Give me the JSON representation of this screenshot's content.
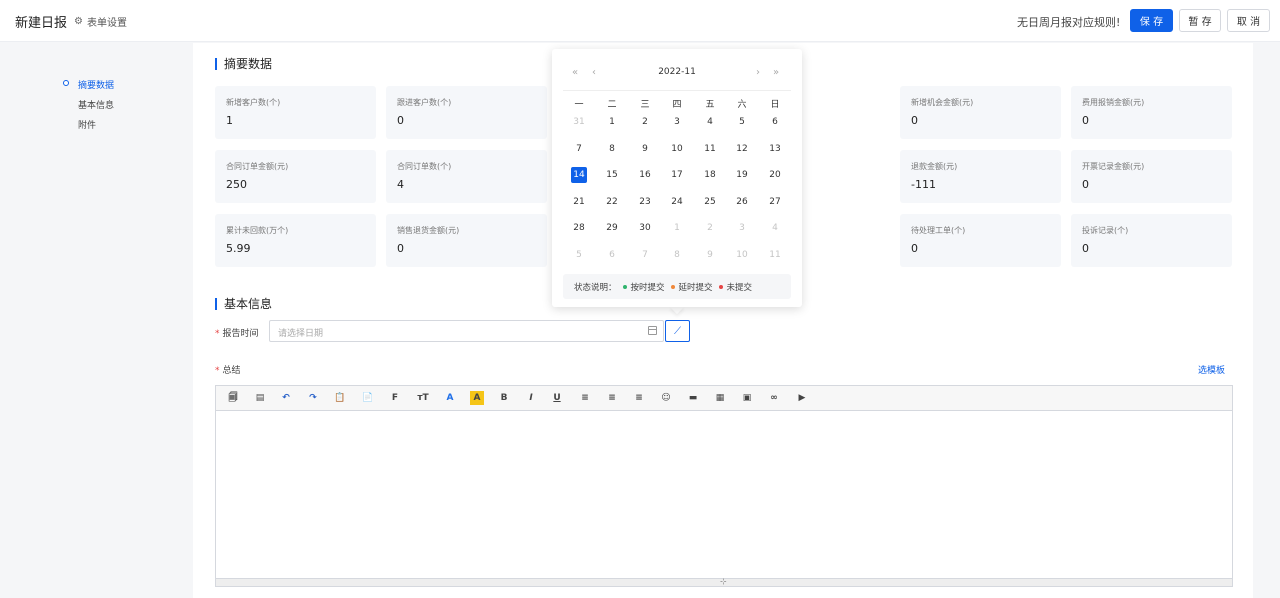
{
  "header": {
    "title": "新建日报",
    "form_settings": "表单设置",
    "rule_text": "无日周月报对应规则!",
    "save": "保 存",
    "draft": "暂 存",
    "cancel": "取 消"
  },
  "sidebar": {
    "items": [
      {
        "label": "摘要数据"
      },
      {
        "label": "基本信息"
      },
      {
        "label": "附件"
      }
    ]
  },
  "summary": {
    "title": "摘要数据",
    "cards": [
      {
        "label": "新增客户数(个)",
        "value": "1"
      },
      {
        "label": "跟进客户数(个)",
        "value": "0"
      },
      {
        "label": "新增机会金额(元)",
        "value": "0"
      },
      {
        "label": "费用报销金额(元)",
        "value": "0"
      },
      {
        "label": "合同订单金额(元)",
        "value": "250"
      },
      {
        "label": "合同订单数(个)",
        "value": "4"
      },
      {
        "label": "退款金额(元)",
        "value": "-111"
      },
      {
        "label": "开票记录金额(元)",
        "value": "0"
      },
      {
        "label": "累计未回款(万个)",
        "value": "5.99"
      },
      {
        "label": "销售退货金额(元)",
        "value": "0"
      },
      {
        "label": "待处理工单(个)",
        "value": "0"
      },
      {
        "label": "投诉记录(个)",
        "value": "0"
      }
    ]
  },
  "basic": {
    "title": "基本信息",
    "report_time_label": "报告时间",
    "date_placeholder": "请选择日期",
    "summary_label": "总结",
    "template_link": "选模板"
  },
  "calendar": {
    "month": "2022-11",
    "weekdays": [
      "一",
      "二",
      "三",
      "四",
      "五",
      "六",
      "日"
    ],
    "weeks": [
      [
        "31",
        "1",
        "2",
        "3",
        "4",
        "5",
        "6"
      ],
      [
        "7",
        "8",
        "9",
        "10",
        "11",
        "12",
        "13"
      ],
      [
        "14",
        "15",
        "16",
        "17",
        "18",
        "19",
        "20"
      ],
      [
        "21",
        "22",
        "23",
        "24",
        "25",
        "26",
        "27"
      ],
      [
        "28",
        "29",
        "30",
        "1",
        "2",
        "3",
        "4"
      ],
      [
        "5",
        "6",
        "7",
        "8",
        "9",
        "10",
        "11"
      ]
    ],
    "selected": "14",
    "legend_title": "状态说明：",
    "legend": [
      {
        "label": "按时提交",
        "color": "#2fb36d"
      },
      {
        "label": "延时提交",
        "color": "#f0883a"
      },
      {
        "label": "未提交",
        "color": "#e54545"
      }
    ]
  },
  "editor": {
    "toolbar": [
      {
        "icon": "source-icon",
        "glyph": "🗐"
      },
      {
        "icon": "template-icon",
        "glyph": "▤"
      },
      {
        "icon": "undo-icon",
        "glyph": "↶"
      },
      {
        "icon": "redo-icon",
        "glyph": "↷"
      },
      {
        "icon": "paste-icon",
        "glyph": "📋"
      },
      {
        "icon": "paste-text-icon",
        "glyph": "📄"
      },
      {
        "icon": "font-family-icon",
        "glyph": "F"
      },
      {
        "icon": "font-size-icon",
        "glyph": "тT"
      },
      {
        "icon": "font-color-icon",
        "glyph": "A"
      },
      {
        "icon": "highlight-icon",
        "glyph": "A"
      },
      {
        "icon": "bold-icon",
        "glyph": "B"
      },
      {
        "icon": "italic-icon",
        "glyph": "I"
      },
      {
        "icon": "underline-icon",
        "glyph": "U"
      },
      {
        "icon": "align-left-icon",
        "glyph": "≡"
      },
      {
        "icon": "align-center-icon",
        "glyph": "≡"
      },
      {
        "icon": "align-right-icon",
        "glyph": "≡"
      },
      {
        "icon": "emoji-icon",
        "glyph": "☺"
      },
      {
        "icon": "insert-line-icon",
        "glyph": "▬"
      },
      {
        "icon": "table-icon",
        "glyph": "▦"
      },
      {
        "icon": "image-icon",
        "glyph": "▣"
      },
      {
        "icon": "link-icon",
        "glyph": "∞"
      },
      {
        "icon": "video-icon",
        "glyph": "▶"
      }
    ]
  }
}
